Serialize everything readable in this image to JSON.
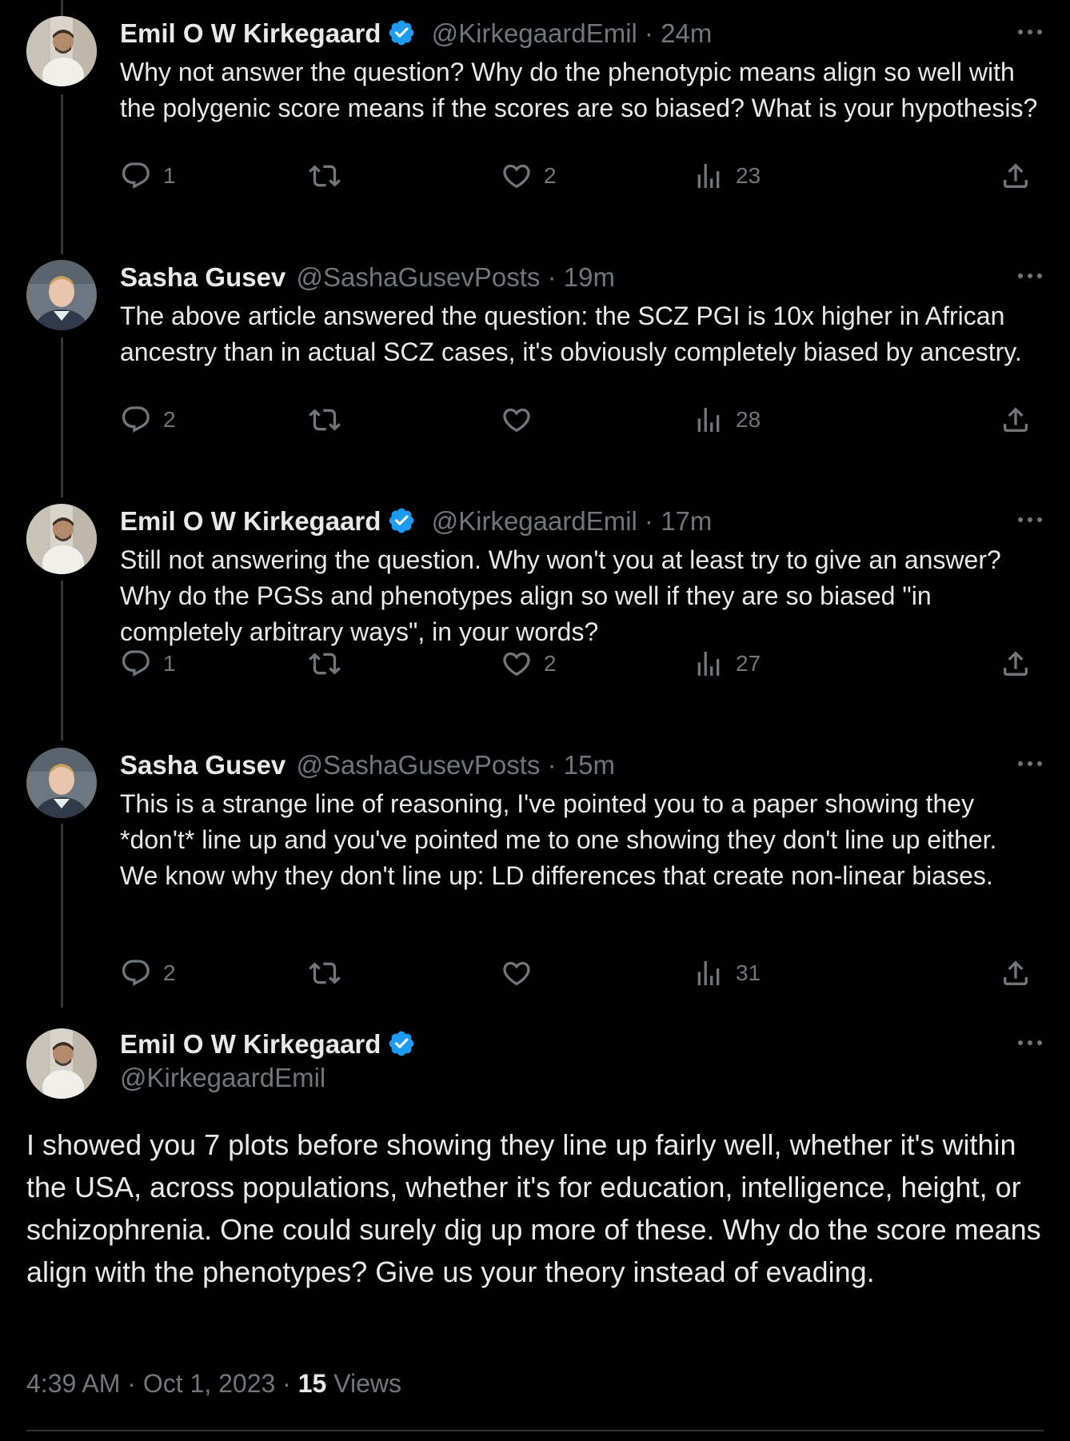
{
  "tweets": [
    {
      "name": "Emil O W Kirkegaard",
      "verified": true,
      "handle": "@KirkegaardEmil",
      "dot": "·",
      "time": "24m",
      "text": "Why not answer the question? Why do the phenotypic means align so well with the polygenic score means if the scores are so biased? What is your hypothesis?",
      "replies": "1",
      "retweets": "",
      "likes": "2",
      "views": "23",
      "avatar": "emil"
    },
    {
      "name": "Sasha Gusev",
      "verified": false,
      "handle": "@SashaGusevPosts",
      "dot": "·",
      "time": "19m",
      "text": "The above article answered the question: the SCZ PGI is 10x higher in African ancestry than in actual SCZ cases, it's obviously completely biased by ancestry.",
      "replies": "2",
      "retweets": "",
      "likes": "",
      "views": "28",
      "avatar": "sasha"
    },
    {
      "name": "Emil O W Kirkegaard",
      "verified": true,
      "handle": "@KirkegaardEmil",
      "dot": "·",
      "time": "17m",
      "text": "Still not answering the question. Why won't you at least try to give an answer? Why do the PGSs and phenotypes align so well if they are so biased \"in completely arbitrary ways\", in your words?",
      "replies": "1",
      "retweets": "",
      "likes": "2",
      "views": "27",
      "avatar": "emil"
    },
    {
      "name": "Sasha Gusev",
      "verified": false,
      "handle": "@SashaGusevPosts",
      "dot": "·",
      "time": "15m",
      "text": "This is a strange line of reasoning, I've pointed you to a paper showing they *don't* line up and you've pointed me to one showing they don't line up either. We know why they don't line up: LD differences that create non-linear biases.",
      "replies": "2",
      "retweets": "",
      "likes": "",
      "views": "31",
      "avatar": "sasha"
    }
  ],
  "main": {
    "name": "Emil O W Kirkegaard",
    "verified": true,
    "handle": "@KirkegaardEmil",
    "text": "I showed you 7 plots before showing they line up fairly well, whether it's within the USA, across populations, whether it's for education, intelligence, height, or schizophrenia. One could surely dig up more of these. Why do the score means align with the phenotypes? Give us your theory instead of evading.",
    "time": "4:39 AM",
    "dot1": "·",
    "date": "Oct 1, 2023",
    "dot2": "·",
    "views_count": "15",
    "views_label": "Views"
  },
  "colors": {
    "verified": "#1d9bf0",
    "muted": "#71767b",
    "text": "#e7e9ea"
  },
  "icons": [
    "reply-icon",
    "retweet-icon",
    "like-icon",
    "views-icon",
    "share-icon",
    "more-icon",
    "verified-icon"
  ]
}
